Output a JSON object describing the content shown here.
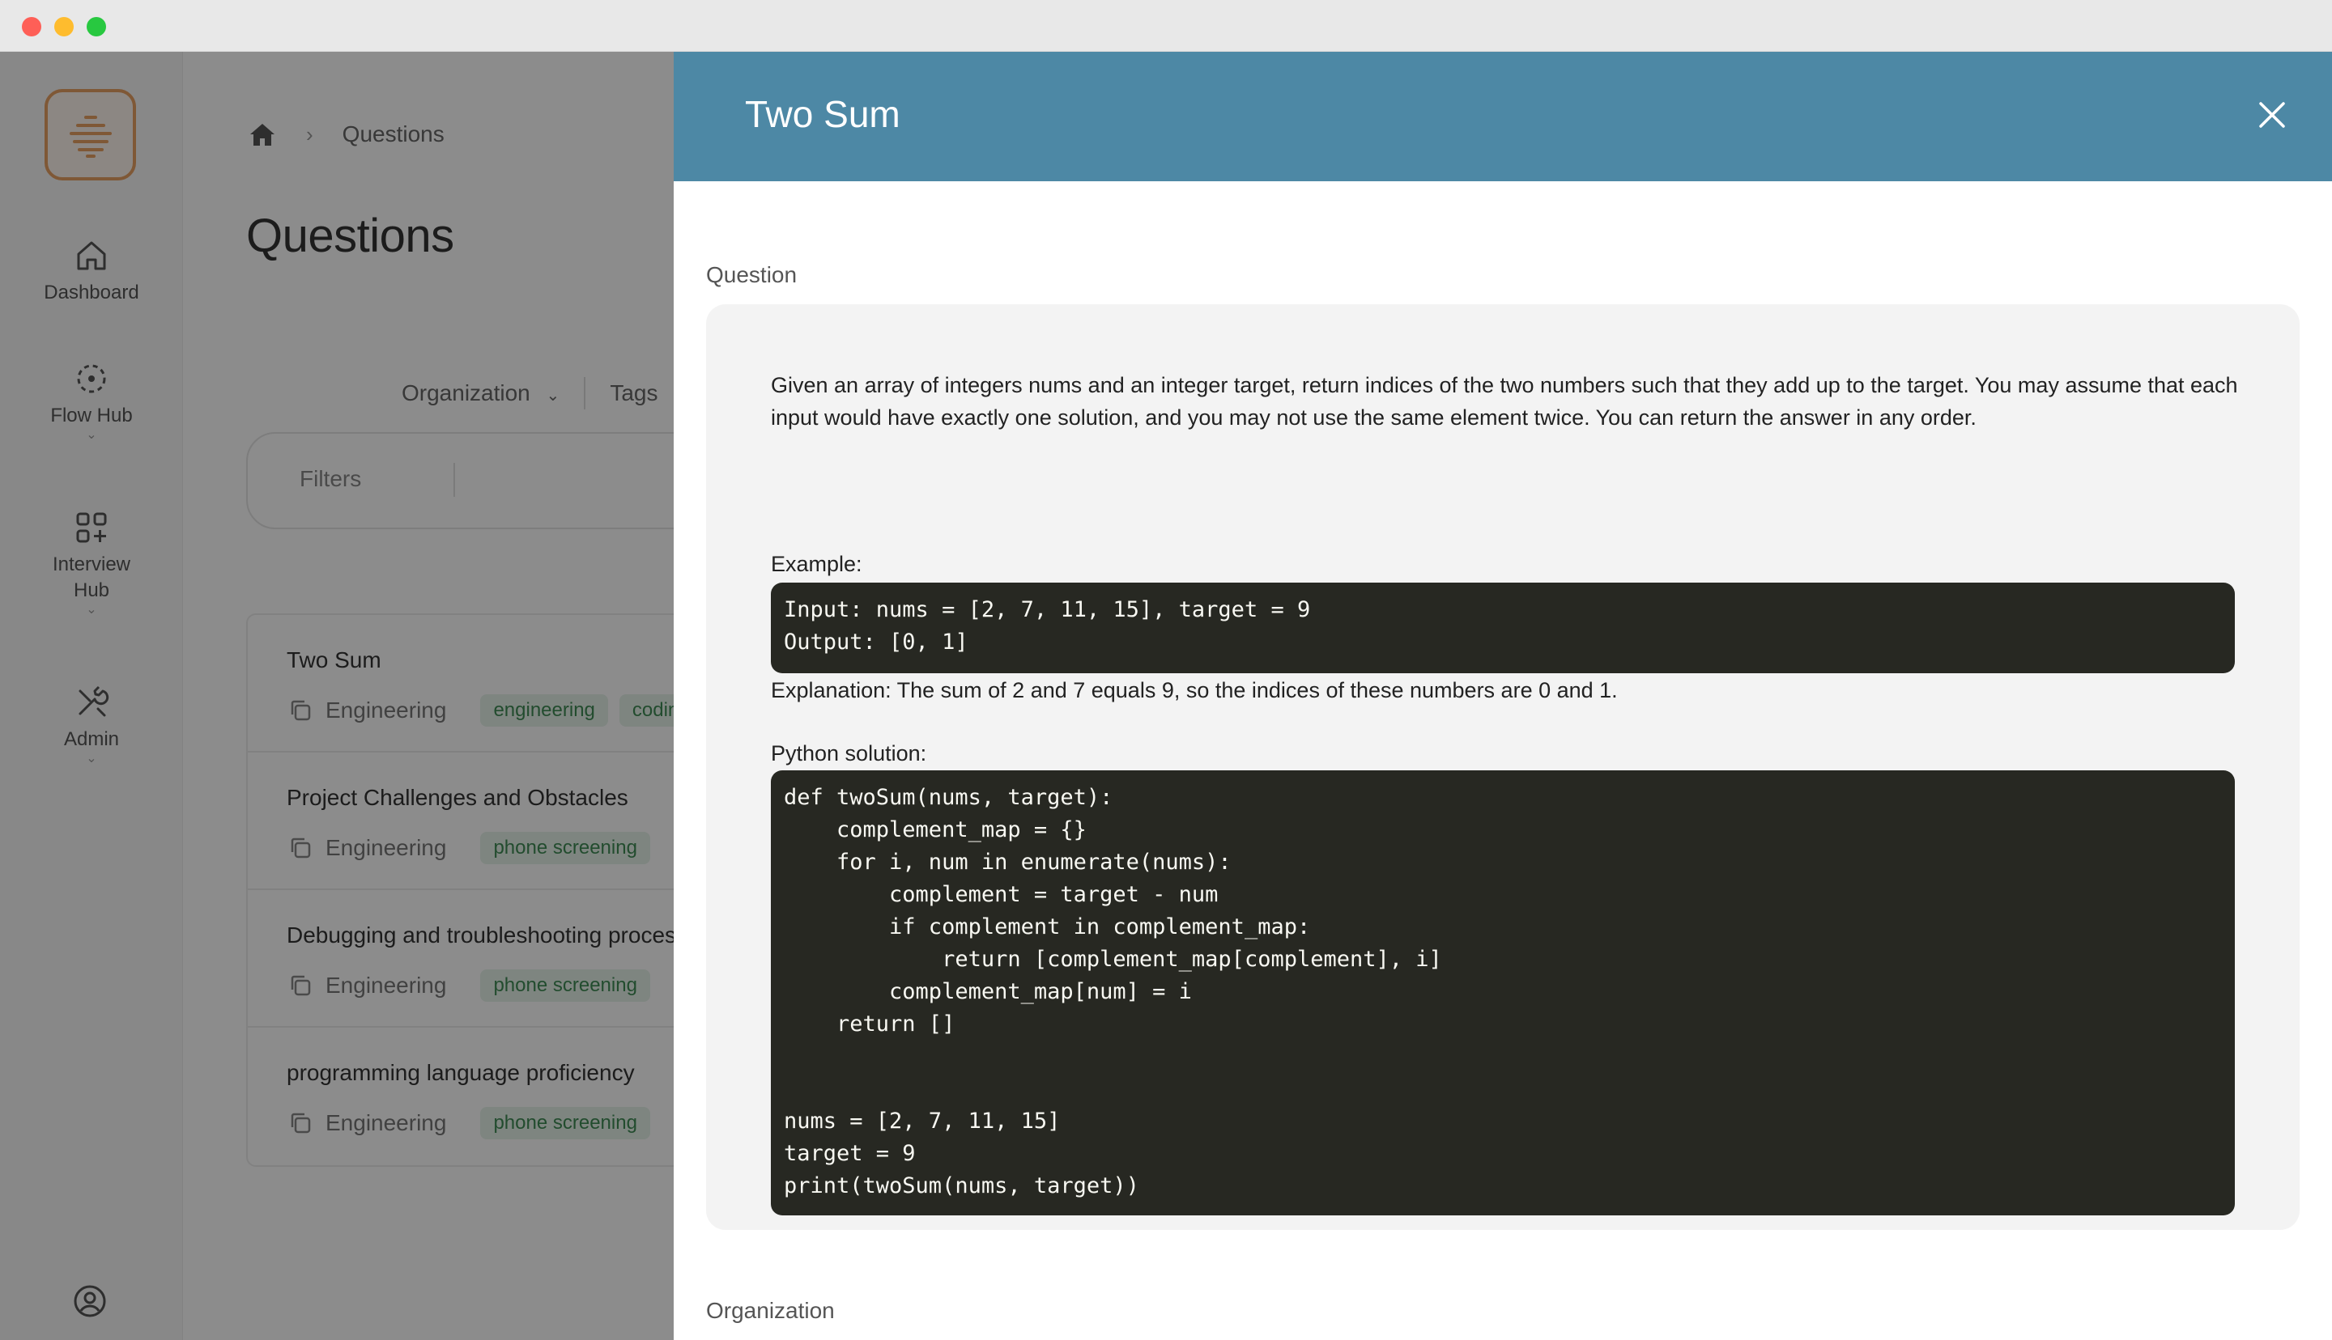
{
  "app": {
    "nav": [
      {
        "label": "Dashboard",
        "icon": "home-icon"
      },
      {
        "label": "Flow Hub",
        "icon": "flow-icon"
      },
      {
        "label": "Interview Hub",
        "icon": "grid-plus-icon"
      },
      {
        "label": "Admin",
        "icon": "tools-icon"
      }
    ],
    "colors": {
      "accent": "#4d88a5",
      "logo": "#e8a063",
      "tag_bg": "#e6f3ea",
      "tag_fg": "#3f8a55",
      "code_bg": "#272822"
    }
  },
  "breadcrumb": {
    "current": "Questions"
  },
  "page": {
    "title": "Questions"
  },
  "filters": {
    "organization_label": "Organization",
    "tags_label": "Tags",
    "filters_placeholder": "Filters"
  },
  "questions": [
    {
      "title": "Two Sum",
      "org": "Engineering",
      "tag1": "engineering",
      "tag2": "coding"
    },
    {
      "title": "Project Challenges and Obstacles",
      "org": "Engineering",
      "tag1": "phone screening"
    },
    {
      "title": "Debugging and troubleshooting process",
      "org": "Engineering",
      "tag1": "phone screening"
    },
    {
      "title": "programming language proficiency",
      "org": "Engineering",
      "tag1": "phone screening"
    }
  ],
  "drawer": {
    "title": "Two Sum",
    "question_label": "Question",
    "question_text": "Given an array of integers nums and an integer target, return indices of the two numbers such that they add up to the target. You may assume that each input would have exactly one solution, and you may not use the same element twice. You can return the answer in any order.",
    "example_label": "Example:",
    "example_code": "Input: nums = [2, 7, 11, 15], target = 9\nOutput: [0, 1]",
    "explanation": "Explanation: The sum of 2 and 7 equals 9, so the indices of these numbers are 0 and 1.",
    "solution_label": "Python solution:",
    "solution_code": "def twoSum(nums, target):\n    complement_map = {}\n    for i, num in enumerate(nums):\n        complement = target - num\n        if complement in complement_map:\n            return [complement_map[complement], i]\n        complement_map[num] = i\n    return []\n\n\nnums = [2, 7, 11, 15]\ntarget = 9\nprint(twoSum(nums, target))",
    "organization_label": "Organization"
  }
}
